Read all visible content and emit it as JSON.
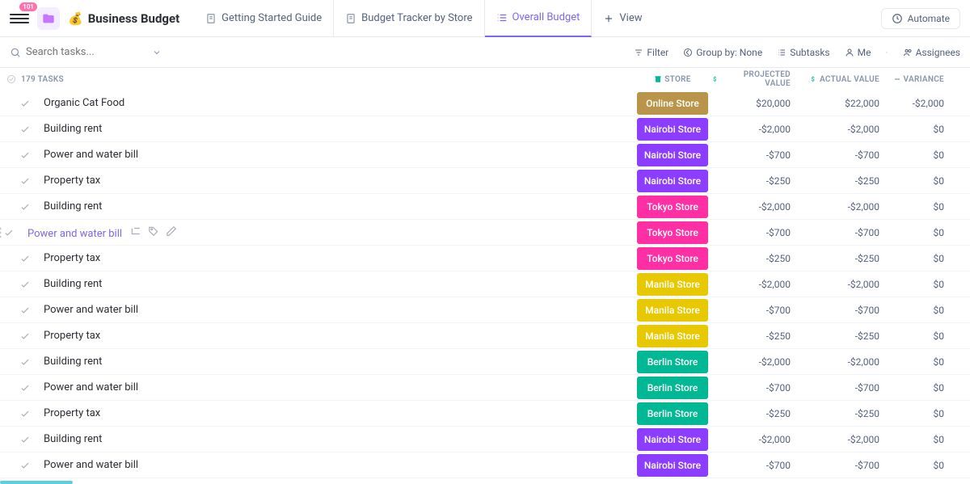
{
  "badge": "101",
  "title": "Business Budget",
  "title_emoji": "💰",
  "tabs": [
    {
      "label": "Getting Started Guide",
      "active": false
    },
    {
      "label": "Budget Tracker by Store",
      "active": false
    },
    {
      "label": "Overall Budget",
      "active": true
    },
    {
      "label": "View",
      "add": true
    }
  ],
  "automate": "Automate",
  "search": {
    "placeholder": "Search tasks...",
    "filter": "Filter",
    "groupby": "Group by: None",
    "subtasks": "Subtasks",
    "me": "Me",
    "assignees": "Assignees"
  },
  "tasks_header": "179 TASKS",
  "columns": {
    "store": "STORE",
    "projected": "PROJECTED VALUE",
    "actual": "ACTUAL VALUE",
    "variance": "VARIANCE"
  },
  "store_colors": {
    "Online Store": "#b8954a",
    "Nairobi Store": "#8c3dff",
    "Tokyo Store": "#ff2fa4",
    "Manila Store": "#e8c800",
    "Berlin Store": "#00b894"
  },
  "rows": [
    {
      "name": "Organic Cat Food",
      "store": "Online Store",
      "projected": "$20,000",
      "actual": "$22,000",
      "variance": "-$2,000"
    },
    {
      "name": "Building rent",
      "store": "Nairobi Store",
      "projected": "-$2,000",
      "actual": "-$2,000",
      "variance": "$0"
    },
    {
      "name": "Power and water bill",
      "store": "Nairobi Store",
      "projected": "-$700",
      "actual": "-$700",
      "variance": "$0"
    },
    {
      "name": "Property tax",
      "store": "Nairobi Store",
      "projected": "-$250",
      "actual": "-$250",
      "variance": "$0"
    },
    {
      "name": "Building rent",
      "store": "Tokyo Store",
      "projected": "-$2,000",
      "actual": "-$2,000",
      "variance": "$0"
    },
    {
      "name": "Power and water bill",
      "store": "Tokyo Store",
      "projected": "-$700",
      "actual": "-$700",
      "variance": "$0",
      "highlight": true
    },
    {
      "name": "Property tax",
      "store": "Tokyo Store",
      "projected": "-$250",
      "actual": "-$250",
      "variance": "$0"
    },
    {
      "name": "Building rent",
      "store": "Manila Store",
      "projected": "-$2,000",
      "actual": "-$2,000",
      "variance": "$0"
    },
    {
      "name": "Power and water bill",
      "store": "Manila Store",
      "projected": "-$700",
      "actual": "-$700",
      "variance": "$0"
    },
    {
      "name": "Property tax",
      "store": "Manila Store",
      "projected": "-$250",
      "actual": "-$250",
      "variance": "$0"
    },
    {
      "name": "Building rent",
      "store": "Berlin Store",
      "projected": "-$2,000",
      "actual": "-$2,000",
      "variance": "$0"
    },
    {
      "name": "Power and water bill",
      "store": "Berlin Store",
      "projected": "-$700",
      "actual": "-$700",
      "variance": "$0"
    },
    {
      "name": "Property tax",
      "store": "Berlin Store",
      "projected": "-$250",
      "actual": "-$250",
      "variance": "$0"
    },
    {
      "name": "Building rent",
      "store": "Nairobi Store",
      "projected": "-$2,000",
      "actual": "-$2,000",
      "variance": "$0"
    },
    {
      "name": "Power and water bill",
      "store": "Nairobi Store",
      "projected": "-$700",
      "actual": "-$700",
      "variance": "$0"
    }
  ]
}
